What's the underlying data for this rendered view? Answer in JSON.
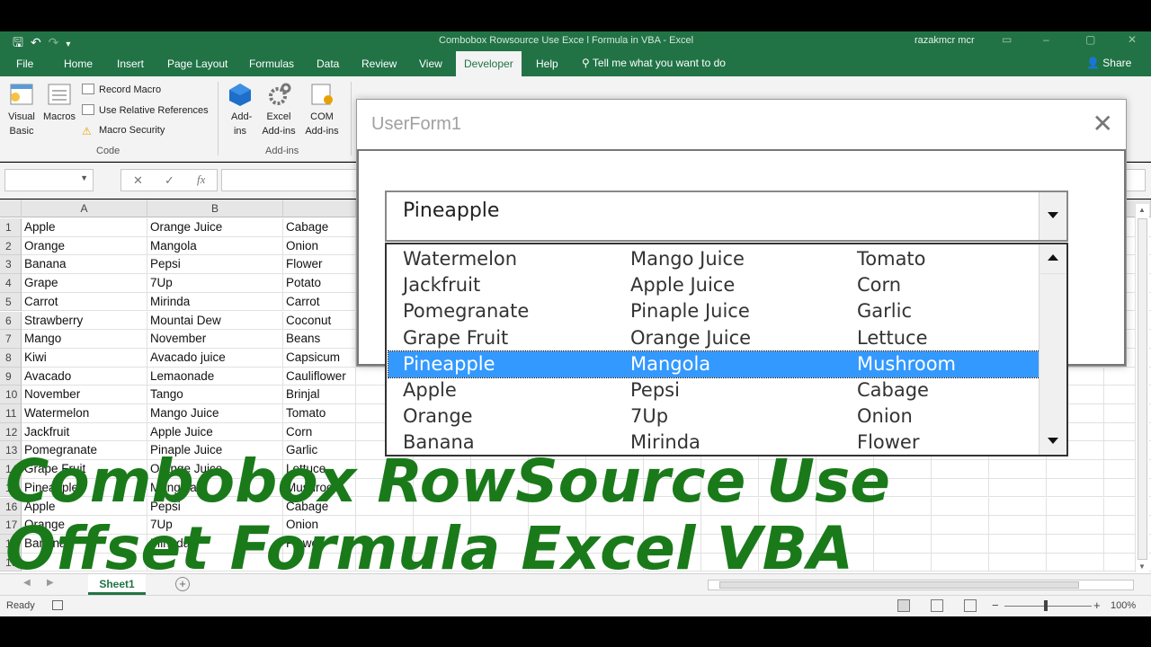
{
  "window": {
    "title": "Combobox Rowsource Use Exce l Formula in VBA  -  Excel",
    "user": "razakmcr mcr",
    "qat_icons": [
      "save-icon",
      "undo-icon",
      "redo-icon",
      "customize-icon"
    ]
  },
  "ribbon_tabs": [
    "File",
    "Home",
    "Insert",
    "Page Layout",
    "Formulas",
    "Data",
    "Review",
    "View",
    "Developer",
    "Help"
  ],
  "active_tab": "Developer",
  "tell_me": "Tell me what you want to do",
  "share": "Share",
  "ribbon": {
    "visual_basic": "Visual Basic",
    "macros": "Macros",
    "record_macro": "Record Macro",
    "use_relative": "Use Relative References",
    "macro_security": "Macro Security",
    "code_group": "Code",
    "addins": "Add-ins",
    "excel_addins": "Excel Add-ins",
    "com_addins": "COM Add-ins",
    "addins_group": "Add-ins"
  },
  "formula_bar": {
    "cancel": "✕",
    "enter": "✓",
    "fx": "fx"
  },
  "columns": [
    "A",
    "B"
  ],
  "rows": [
    [
      "1",
      "Apple",
      "Orange Juice",
      "Cabage"
    ],
    [
      "2",
      "Orange",
      "Mangola",
      "Onion"
    ],
    [
      "3",
      "Banana",
      "Pepsi",
      "Flower"
    ],
    [
      "4",
      "Grape",
      "7Up",
      "Potato"
    ],
    [
      "5",
      "Carrot",
      "Mirinda",
      "Carrot"
    ],
    [
      "6",
      "Strawberry",
      "Mountai Dew",
      "Coconut"
    ],
    [
      "7",
      "Mango",
      "November",
      "Beans"
    ],
    [
      "8",
      "Kiwi",
      "Avacado juice",
      "Capsicum"
    ],
    [
      "9",
      "Avacado",
      "Lemaonade",
      "Cauliflower"
    ],
    [
      "10",
      "November",
      "Tango",
      "Brinjal"
    ],
    [
      "11",
      "Watermelon",
      "Mango Juice",
      "Tomato"
    ],
    [
      "12",
      "Jackfruit",
      "Apple Juice",
      "Corn"
    ],
    [
      "13",
      "Pomegranate",
      "Pinaple Juice",
      "Garlic"
    ],
    [
      "14",
      "Grape Fruit",
      "Orange Juice",
      "Lettuce"
    ],
    [
      "15",
      "Pineapple",
      "Mangola",
      "Mushroom"
    ],
    [
      "16",
      "Apple",
      "Pepsi",
      "Cabage"
    ],
    [
      "17",
      "Orange",
      "7Up",
      "Onion"
    ],
    [
      "18",
      "Banana",
      "Mirinda",
      "Flower"
    ],
    [
      "19",
      "",
      "",
      ""
    ]
  ],
  "userform": {
    "title": "UserForm1",
    "combo_value": "Pineapple",
    "list": [
      [
        "Watermelon",
        "Mango Juice",
        "Tomato"
      ],
      [
        "Jackfruit",
        "Apple Juice",
        "Corn"
      ],
      [
        "Pomegranate",
        "Pinaple Juice",
        "Garlic"
      ],
      [
        "Grape Fruit",
        "Orange Juice",
        "Lettuce"
      ],
      [
        "Pineapple",
        "Mangola",
        "Mushroom"
      ],
      [
        "Apple",
        "Pepsi",
        "Cabage"
      ],
      [
        "Orange",
        "7Up",
        "Onion"
      ],
      [
        "Banana",
        "Mirinda",
        "Flower"
      ]
    ],
    "selected_index": 4
  },
  "overlay": {
    "line1": "Combobox RowSource Use",
    "line2": "Offset Formula Excel VBA",
    "color": "#1a7a1a"
  },
  "sheet_tab": "Sheet1",
  "status": {
    "ready": "Ready",
    "zoom": "100%"
  },
  "colors": {
    "excel_green": "#217346",
    "selection_blue": "#3399ff"
  }
}
